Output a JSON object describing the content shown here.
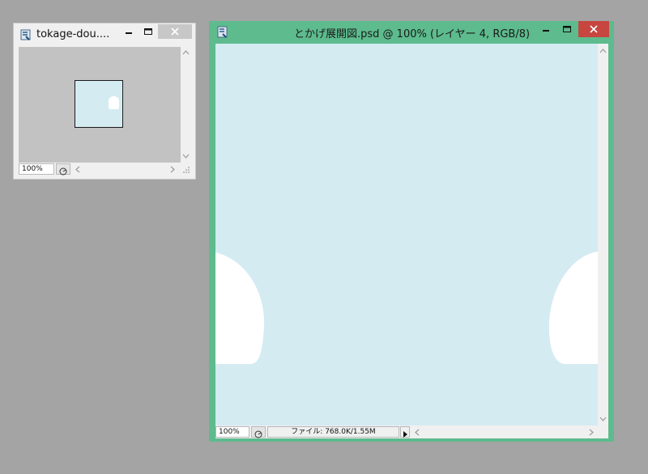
{
  "navigator_window": {
    "title": "tokage-dou....",
    "zoom": "100%",
    "buttons": {
      "minimize_icon": "minimize-icon",
      "maximize_icon": "maximize-icon",
      "close_icon": "close-icon"
    }
  },
  "document_window": {
    "title": "とかげ展開図.psd @ 100% (レイヤー 4, RGB/8)",
    "zoom": "100%",
    "file_info": "ファイル: 768.0K/1.55M",
    "buttons": {
      "minimize_icon": "minimize-icon",
      "maximize_icon": "maximize-icon",
      "close_icon": "close-icon"
    }
  },
  "colors": {
    "desktop": "#a4a4a4",
    "document_frame": "#5dbb8e",
    "canvas_fill": "#d4ebf2",
    "close_active": "#c7463f",
    "shape_fill": "#ffffff"
  }
}
